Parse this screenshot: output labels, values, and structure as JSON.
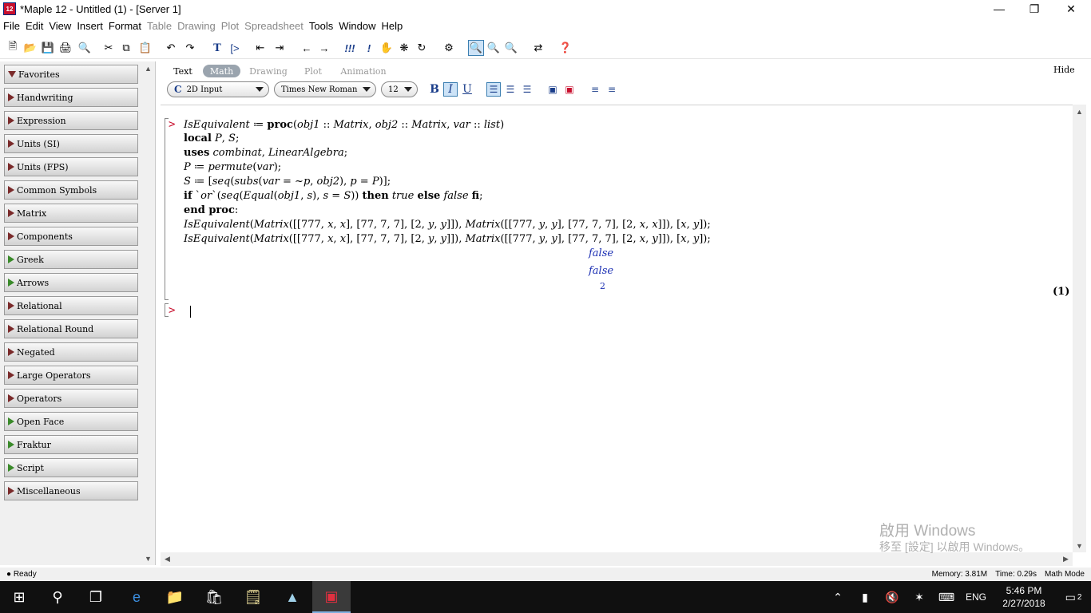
{
  "window": {
    "title": "*Maple 12 - Untitled (1) - [Server 1]",
    "app_icon": "12"
  },
  "menu": [
    "File",
    "Edit",
    "View",
    "Insert",
    "Format",
    "Table",
    "Drawing",
    "Plot",
    "Spreadsheet",
    "Tools",
    "Window",
    "Help"
  ],
  "menu_disabled": [
    "Table",
    "Drawing",
    "Plot",
    "Spreadsheet"
  ],
  "palettes": [
    "Favorites",
    "Handwriting",
    "Expression",
    "Units (SI)",
    "Units (FPS)",
    "Common Symbols",
    "Matrix",
    "Components",
    "Greek",
    "Arrows",
    "Relational",
    "Relational Round",
    "Negated",
    "Large Operators",
    "Operators",
    "Open Face",
    "Fraktur",
    "Script",
    "Miscellaneous"
  ],
  "context": {
    "tabs": [
      "Text",
      "Math",
      "Drawing",
      "Plot",
      "Animation"
    ],
    "selected_tab": "Math",
    "hide_label": "Hide",
    "input_mode": "2D Input",
    "font": "Times New Roman",
    "size": "12",
    "input_mode_glyph": "C",
    "bold": "B",
    "italic": "I",
    "underline": "U"
  },
  "worksheet": {
    "outputs": [
      "false",
      "false",
      "2"
    ],
    "equation_label": "(1)",
    "prompt": ">"
  },
  "watermark": {
    "line1": "啟用 Windows",
    "line2": "移至 [設定] 以啟用 Windows。"
  },
  "status": {
    "left": "Ready",
    "memory": "Memory: 3.81M",
    "time": "Time: 0.29s",
    "mode": "Math Mode"
  },
  "taskbar": {
    "time": "5:46 PM",
    "date": "2/27/2018",
    "lang": "ENG",
    "notifications": "2"
  },
  "colors": {
    "prompt": "#c8102e",
    "output": "#1b2fb3",
    "accent": "#3c7fb1"
  }
}
